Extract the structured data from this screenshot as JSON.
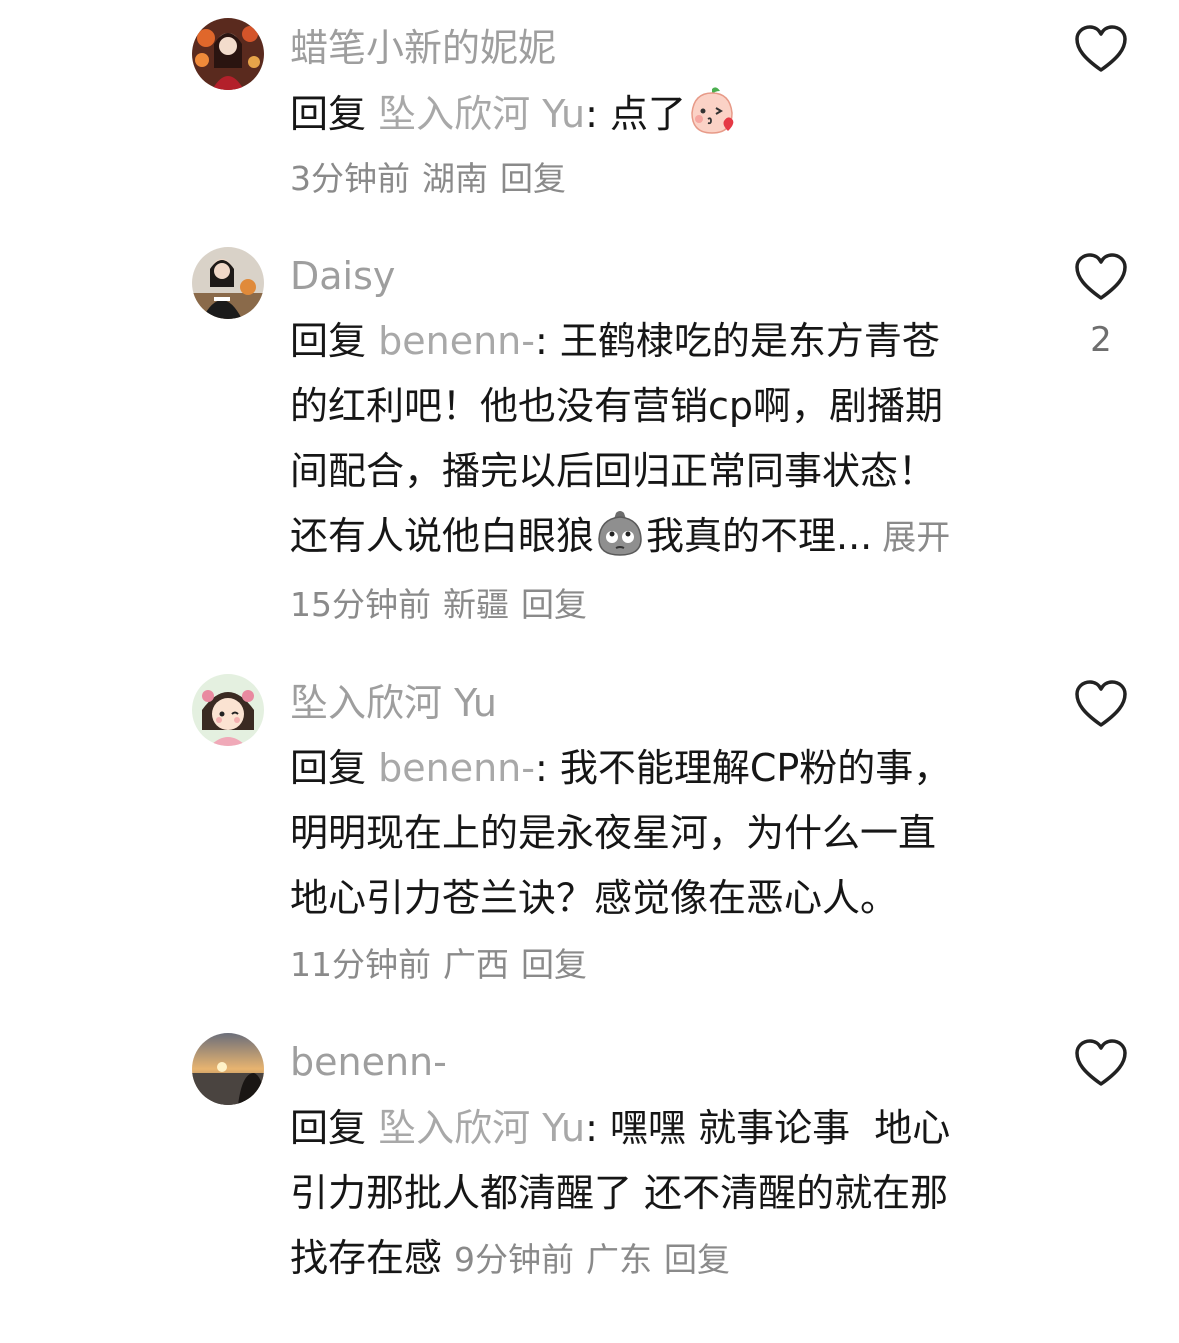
{
  "comments": [
    {
      "username": "蜡笔小新的妮妮",
      "reply_prefix": "回复",
      "reply_target": "坠入欣河 Yu",
      "text": "点了",
      "emoji": "kissing-peach-emoji",
      "time": "3分钟前",
      "location": "湖南",
      "reply_label": "回复",
      "likes": ""
    },
    {
      "username": "Daisy",
      "reply_prefix": "回复",
      "reply_target": "benenn-",
      "text_lines": [
        "王鹤棣吃的是东方青苍",
        "的红利吧！他也没有营销cp啊，剧播期",
        "间配合，播完以后回归正常同事状态！",
        "还有人说他白眼狼"
      ],
      "emoji": "eyeroll-bag-emoji",
      "text_tail": "我真的不理...",
      "expand_label": "展开",
      "time": "15分钟前",
      "location": "新疆",
      "reply_label": "回复",
      "likes": "2"
    },
    {
      "username": "坠入欣河 Yu",
      "reply_prefix": "回复",
      "reply_target": "benenn-",
      "text_lines": [
        "我不能理解CP粉的事，",
        "明明现在上的是永夜星河，为什么一直",
        "地心引力苍兰诀？感觉像在恶心人。"
      ],
      "time": "11分钟前",
      "location": "广西",
      "reply_label": "回复",
      "likes": ""
    },
    {
      "username": "benenn-",
      "reply_prefix": "回复",
      "reply_target": "坠入欣河 Yu",
      "text_lines": [
        "嘿嘿 就事论事  地心",
        "引力那批人都清醒了 还不清醒的就在那",
        "找存在感"
      ],
      "time": "9分钟前",
      "location": "广东",
      "reply_label": "回复",
      "likes": ""
    }
  ],
  "icons": {
    "like": "heart-outline-icon"
  },
  "colors": {
    "text": "#161616",
    "muted": "#9e9e9e",
    "meta": "#8a8a8a"
  }
}
